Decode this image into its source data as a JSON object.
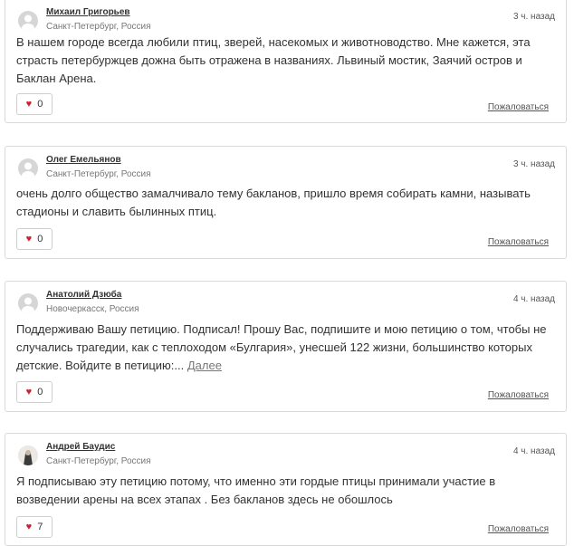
{
  "comments": [
    {
      "author": "Михаил Григорьев",
      "location": "Санкт-Петербург, Россия",
      "time": "3 ч. назад",
      "text": "В нашем городе всегда любили птиц, зверей, насекомых и животноводство. Мне кажется, эта страсть петербуржцев дожна быть отражена в названиях. Львиный мостик, Заячий остров и Баклан Арена.",
      "likes": "0",
      "report": "Пожаловаться"
    },
    {
      "author": "Олег Емельянов",
      "location": "Санкт-Петербург, Россия",
      "time": "3 ч. назад",
      "text": "очень долго общество замалчивало тему бакланов, пришло время собирать камни, называть стадионы и славить былинных птиц.",
      "likes": "0",
      "report": "Пожаловаться"
    },
    {
      "author": "Анатолий Дзюба",
      "location": "Новочеркасск, Россия",
      "time": "4 ч. назад",
      "text": "Поддерживаю Вашу петицию. Подписал! Прошу Вас, подпишите и мою петицию о том, чтобы не случались трагедии, как с теплоходом «Булгария», унесшей 122 жизни, большинство которых детские. Войдите в петицию:...",
      "more": "Далее",
      "likes": "0",
      "report": "Пожаловаться"
    },
    {
      "author": "Андрей Баудис",
      "location": "Санкт-Петербург, Россия",
      "time": "4 ч. назад",
      "text": "Я подписываю эту петицию потому, что именно эти гордые птицы принимали участие в возведении арены на всех этапах . Без бакланов здесь не обошлось",
      "likes": "7",
      "report": "Пожаловаться"
    }
  ],
  "icons": {
    "like": "heart-icon",
    "avatar": "user-avatar-icon"
  },
  "colors": {
    "heart": "#d0202f",
    "border": "#d9d9d9"
  }
}
